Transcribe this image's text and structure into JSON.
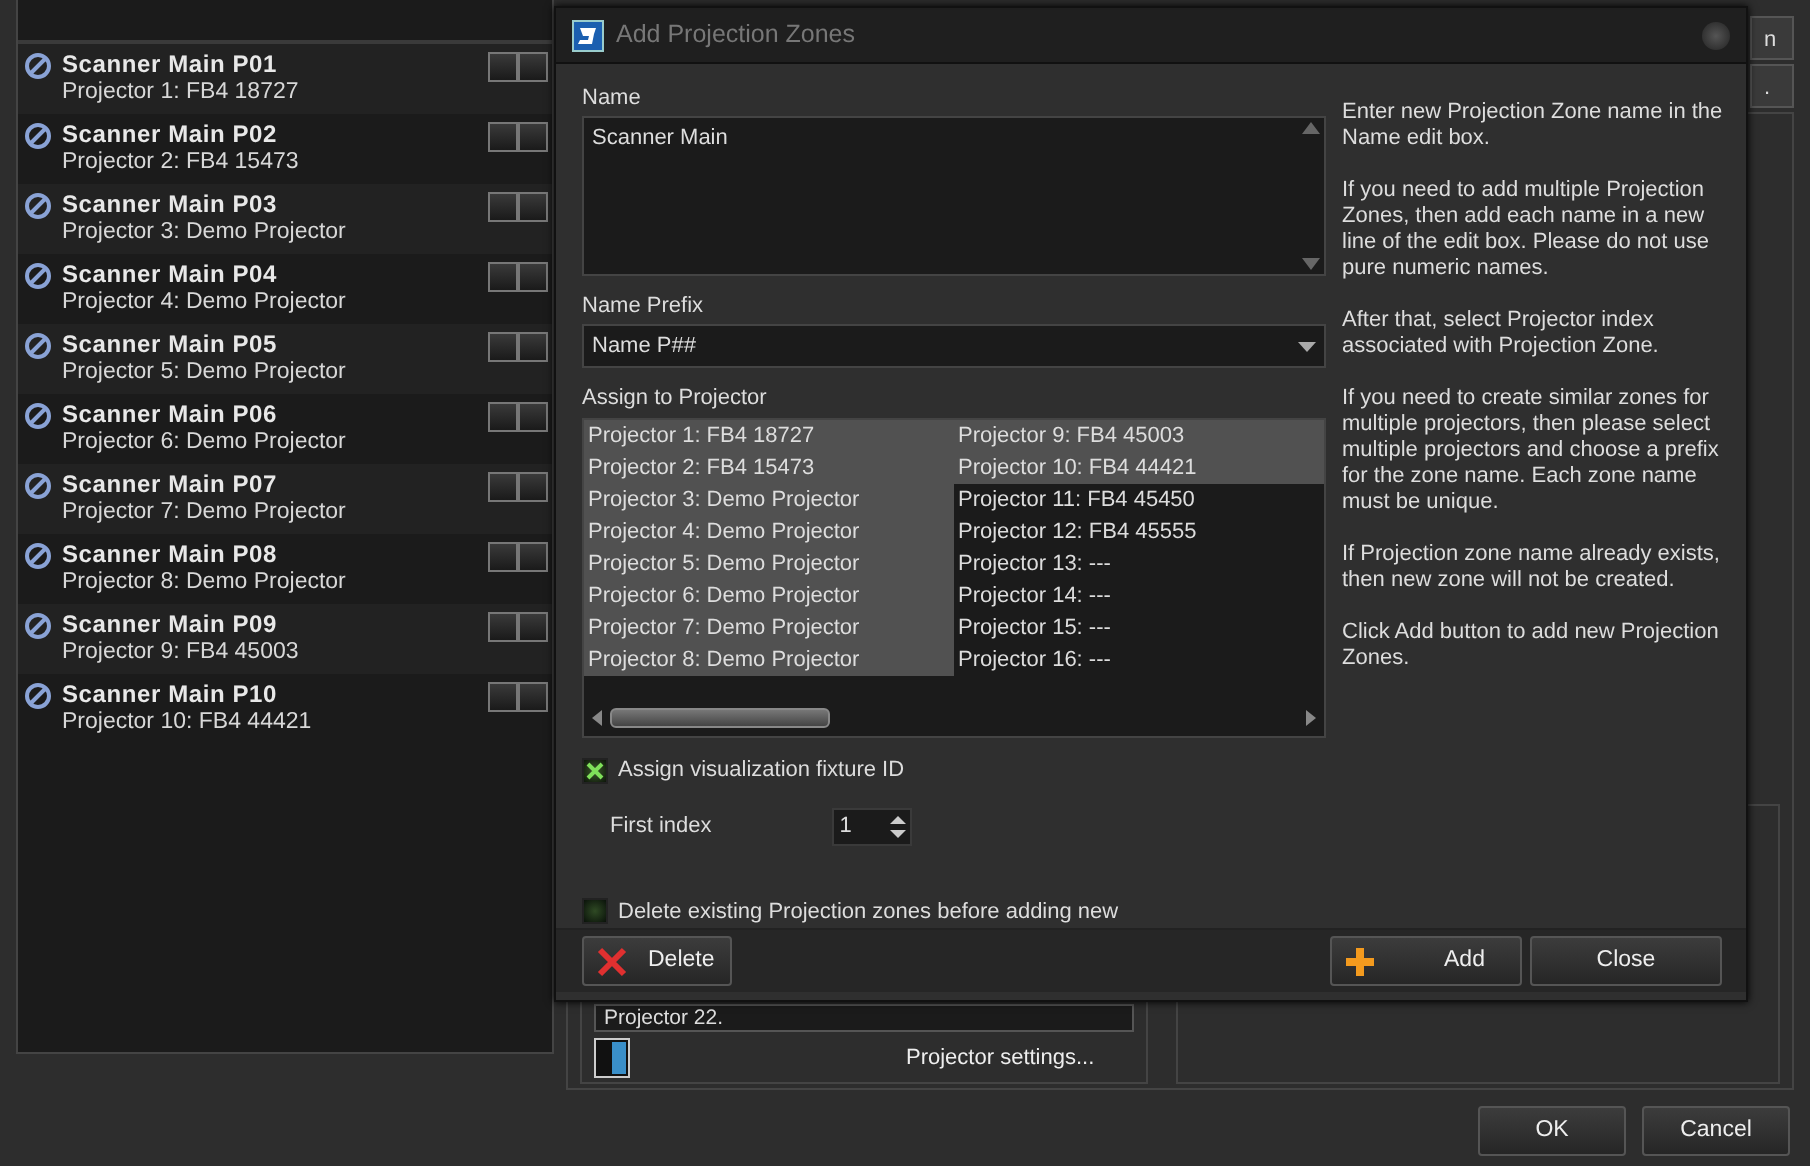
{
  "zones": [
    {
      "name": "Scanner Main P01",
      "projector": "Projector 1: FB4 18727",
      "toggles": [
        false,
        false
      ]
    },
    {
      "name": "Scanner Main P02",
      "projector": "Projector 2: FB4 15473",
      "toggles": [
        false,
        false
      ]
    },
    {
      "name": "Scanner Main P03",
      "projector": "Projector 3: Demo Projector",
      "toggles": [
        false,
        false
      ]
    },
    {
      "name": "Scanner Main P04",
      "projector": "Projector 4: Demo Projector",
      "toggles": [
        false,
        false
      ]
    },
    {
      "name": "Scanner Main P05",
      "projector": "Projector 5: Demo Projector",
      "toggles": [
        false,
        false
      ]
    },
    {
      "name": "Scanner Main P06",
      "projector": "Projector 6: Demo Projector",
      "toggles": [
        false,
        false
      ]
    },
    {
      "name": "Scanner Main P07",
      "projector": "Projector 7: Demo Projector",
      "toggles": [
        false,
        false
      ]
    },
    {
      "name": "Scanner Main P08",
      "projector": "Projector 8: Demo Projector",
      "toggles": [
        false,
        false
      ]
    },
    {
      "name": "Scanner Main P09",
      "projector": "Projector 9: FB4 45003",
      "toggles": [
        false,
        false
      ]
    },
    {
      "name": "Scanner Main P10",
      "projector": "Projector 10: FB4 44421",
      "toggles": [
        false,
        false
      ]
    }
  ],
  "top_tabs": [
    {
      "label": "n"
    },
    {
      "label": "."
    }
  ],
  "background_panel": {
    "projector_field": "Projector 22.",
    "settings_button": "Projector settings..."
  },
  "buttons": [
    "OK",
    "Cancel"
  ],
  "dialog": {
    "title": "Add Projection Zones",
    "name_label": "Name",
    "name_value": "Scanner Main",
    "prefix_label": "Name Prefix",
    "prefix_value": "Name P##",
    "assign_label": "Assign to Projector",
    "projectors": [
      {
        "label": "Projector 1: FB4 18727",
        "selected": true
      },
      {
        "label": "Projector 2: FB4 15473",
        "selected": true
      },
      {
        "label": "Projector 3: Demo Projector",
        "selected": true
      },
      {
        "label": "Projector 4: Demo Projector",
        "selected": true
      },
      {
        "label": "Projector 5: Demo Projector",
        "selected": true
      },
      {
        "label": "Projector 6: Demo Projector",
        "selected": true
      },
      {
        "label": "Projector 7: Demo Projector",
        "selected": true
      },
      {
        "label": "Projector 8: Demo Projector",
        "selected": true
      },
      {
        "label": "Projector 9: FB4 45003",
        "selected": true
      },
      {
        "label": "Projector 10: FB4 44421",
        "selected": true
      },
      {
        "label": "Projector 11: FB4 45450",
        "selected": false
      },
      {
        "label": "Projector 12: FB4 45555",
        "selected": false
      },
      {
        "label": "Projector 13: ---",
        "selected": false
      },
      {
        "label": "Projector 14: ---",
        "selected": false
      },
      {
        "label": "Projector 15: ---",
        "selected": false
      },
      {
        "label": "Projector 16: ---",
        "selected": false
      }
    ],
    "assign_fixture": {
      "label": "Assign visualization fixture ID",
      "checked": true
    },
    "first_index": {
      "label": "First index",
      "value": "1"
    },
    "delete_existing": {
      "label": "Delete existing Projection zones before adding new",
      "checked": false
    },
    "help": [
      "Enter new Projection Zone name in the Name edit box.",
      "If you need to add multiple Projection Zones, then add each name in a new line of the edit box. Please do not use pure numeric names.",
      "After that, select Projector index associated with Projection Zone.",
      "If you need to create similar zones for multiple projectors, then please select multiple projectors and choose a prefix for the zone name. Each zone name must be unique.",
      "If Projection zone name already exists, then new zone will not be created.",
      "Click Add button to add new Projection Zones."
    ],
    "buttons": [
      {
        "label": "Delete",
        "kind": "delete"
      },
      {
        "label": "Add",
        "kind": "add"
      },
      {
        "label": "Close",
        "kind": "plain"
      }
    ]
  }
}
